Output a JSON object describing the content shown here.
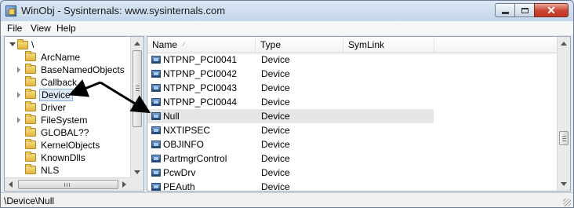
{
  "window": {
    "title": "WinObj - Sysinternals: www.sysinternals.com",
    "buttons": {
      "minimize": "minimize",
      "maximize": "maximize",
      "close": "close"
    }
  },
  "menu": [
    "File",
    "View",
    "Help"
  ],
  "tree": {
    "root": "\\",
    "items": [
      {
        "label": "ArcName",
        "expandable": false
      },
      {
        "label": "BaseNamedObjects",
        "expandable": true
      },
      {
        "label": "Callback",
        "expandable": false
      },
      {
        "label": "Device",
        "expandable": true,
        "selected": true
      },
      {
        "label": "Driver",
        "expandable": false
      },
      {
        "label": "FileSystem",
        "expandable": true
      },
      {
        "label": "GLOBAL??",
        "expandable": false
      },
      {
        "label": "KernelObjects",
        "expandable": false
      },
      {
        "label": "KnownDlls",
        "expandable": false
      },
      {
        "label": "NLS",
        "expandable": false
      }
    ]
  },
  "list": {
    "columns": [
      "Name",
      "Type",
      "SymLink"
    ],
    "sorted_column": "Name",
    "rows": [
      {
        "name": "NTPNP_PCI0041",
        "type": "Device"
      },
      {
        "name": "NTPNP_PCI0042",
        "type": "Device"
      },
      {
        "name": "NTPNP_PCI0043",
        "type": "Device"
      },
      {
        "name": "NTPNP_PCI0044",
        "type": "Device"
      },
      {
        "name": "Null",
        "type": "Device",
        "highlighted": true
      },
      {
        "name": "NXTIPSEC",
        "type": "Device"
      },
      {
        "name": "OBJINFO",
        "type": "Device"
      },
      {
        "name": "PartmgrControl",
        "type": "Device"
      },
      {
        "name": "PcwDrv",
        "type": "Device"
      },
      {
        "name": "PEAuth",
        "type": "Device"
      }
    ]
  },
  "status": {
    "path": "\\Device\\Null"
  },
  "colors": {
    "selection_border": "#84acdd",
    "row_highlight": "#e6e6e6",
    "close_button": "#c9452f",
    "annotation_arrow": "#000000"
  }
}
